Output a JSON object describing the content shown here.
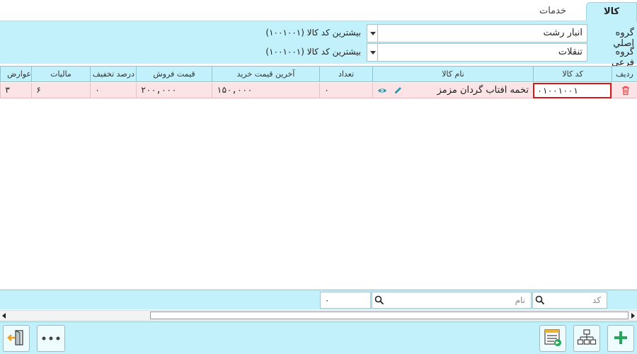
{
  "tabs": {
    "goods": "کالا",
    "services": "خدمات"
  },
  "filters": {
    "main_group_label": "گروه اصلي",
    "main_group_value": "انبار رشت",
    "sub_group_label": "گروه فرعي",
    "sub_group_value": "تنقلات",
    "max_code_label": "بيشترين کد کالا",
    "max_code_value_main": "(۱۰۰۱۰۰۱)",
    "max_code_value_sub": "(۱۰۰۱۰۰۱)"
  },
  "table": {
    "headers": {
      "row": "رديف",
      "code": "کد کالا",
      "name": "نام کالا",
      "qty": "تعداد",
      "last_buy": "آخرين قيمت خريد",
      "sale_price": "قيمت فروش",
      "discount": "درصد تخفيف",
      "tax": "ماليات",
      "duties": "عوارض"
    },
    "rows": [
      {
        "code": "۰۱۰۰۱۰۰۱",
        "name": "تخمه افتاب گردان مزمز",
        "qty": "۰",
        "last_buy": "۱۵۰,۰۰۰",
        "sale_price": "۲۰۰,۰۰۰",
        "discount": "۰",
        "tax": "۶",
        "duties": "۳"
      }
    ]
  },
  "footer": {
    "code_placeholder": "کد",
    "name_placeholder": "نام",
    "count": "۰"
  },
  "icons": {
    "delete": "trash-icon",
    "edit": "pencil-icon",
    "view": "eye-icon",
    "search": "search-icon",
    "exit": "exit-icon",
    "more": "more-icon",
    "list": "list-icon",
    "tree": "tree-icon",
    "add": "plus-icon"
  },
  "colors": {
    "panel": "#c3f1fb",
    "selected_row": "#fbe3e6",
    "highlight_border": "#d7191c",
    "delete_icon": "#e0474c",
    "accent": "#2a9bb0",
    "add_icon": "#26a65b"
  }
}
